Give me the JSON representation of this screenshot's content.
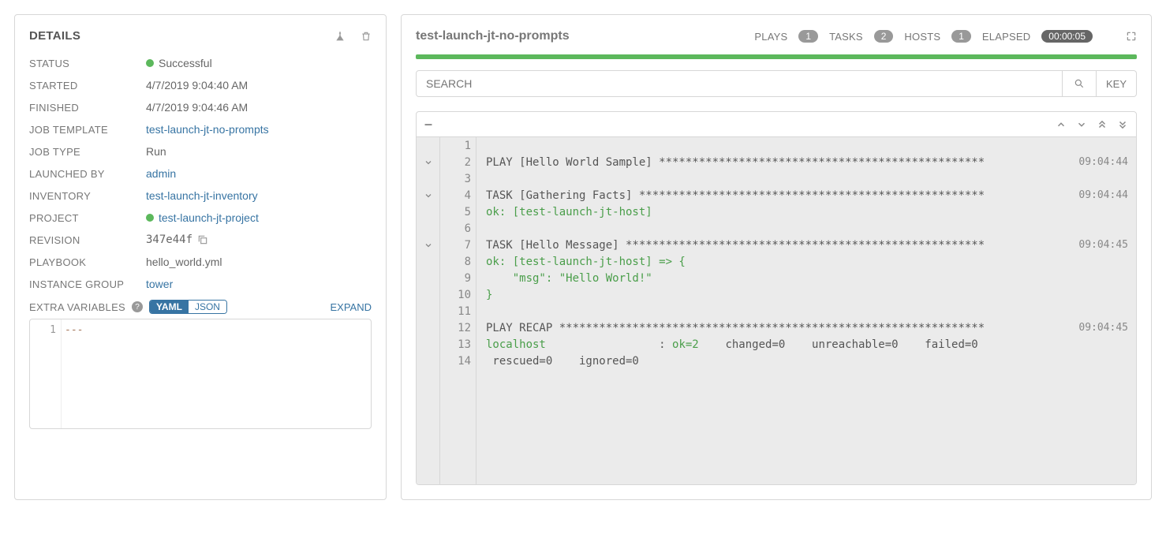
{
  "details": {
    "title": "DETAILS",
    "rows": {
      "status_label": "STATUS",
      "status_value": "Successful",
      "started_label": "STARTED",
      "started_value": "4/7/2019 9:04:40 AM",
      "finished_label": "FINISHED",
      "finished_value": "4/7/2019 9:04:46 AM",
      "template_label": "JOB TEMPLATE",
      "template_value": "test-launch-jt-no-prompts",
      "type_label": "JOB TYPE",
      "type_value": "Run",
      "launched_label": "LAUNCHED BY",
      "launched_value": "admin",
      "inventory_label": "INVENTORY",
      "inventory_value": "test-launch-jt-inventory",
      "project_label": "PROJECT",
      "project_value": "test-launch-jt-project",
      "revision_label": "REVISION",
      "revision_value": "347e44f",
      "playbook_label": "PLAYBOOK",
      "playbook_value": "hello_world.yml",
      "instancegroup_label": "INSTANCE GROUP",
      "instancegroup_value": "tower"
    },
    "extra_vars": {
      "label": "EXTRA VARIABLES",
      "yaml": "YAML",
      "json": "JSON",
      "expand": "EXPAND",
      "editor_line": "1",
      "editor_content": "---"
    }
  },
  "output": {
    "job_name": "test-launch-jt-no-prompts",
    "stats": {
      "plays_label": "PLAYS",
      "plays_count": "1",
      "tasks_label": "TASKS",
      "tasks_count": "2",
      "hosts_label": "HOSTS",
      "hosts_count": "1",
      "elapsed_label": "ELAPSED",
      "elapsed_value": "00:00:05"
    },
    "search_placeholder": "SEARCH",
    "key_label": "KEY",
    "toolbar_collapse": "–",
    "log": {
      "lines": [
        {
          "n": "1",
          "fold": "",
          "text": "",
          "ok": false,
          "ts": ""
        },
        {
          "n": "2",
          "fold": "v",
          "text": "PLAY [Hello World Sample] *************************************************",
          "ok": false,
          "ts": "09:04:44"
        },
        {
          "n": "3",
          "fold": "",
          "text": "",
          "ok": false,
          "ts": ""
        },
        {
          "n": "4",
          "fold": "v",
          "text": "TASK [Gathering Facts] ****************************************************",
          "ok": false,
          "ts": "09:04:44"
        },
        {
          "n": "5",
          "fold": "",
          "text": "ok: [test-launch-jt-host]",
          "ok": true,
          "ts": ""
        },
        {
          "n": "6",
          "fold": "",
          "text": "",
          "ok": false,
          "ts": ""
        },
        {
          "n": "7",
          "fold": "v",
          "text": "TASK [Hello Message] ******************************************************",
          "ok": false,
          "ts": "09:04:45"
        },
        {
          "n": "8",
          "fold": "",
          "text": "ok: [test-launch-jt-host] => {",
          "ok": true,
          "ts": ""
        },
        {
          "n": "9",
          "fold": "",
          "text": "    \"msg\": \"Hello World!\"",
          "ok": true,
          "ts": ""
        },
        {
          "n": "10",
          "fold": "",
          "text": "}",
          "ok": true,
          "ts": ""
        },
        {
          "n": "11",
          "fold": "",
          "text": "",
          "ok": false,
          "ts": ""
        },
        {
          "n": "12",
          "fold": "",
          "text": "PLAY RECAP ****************************************************************",
          "ok": false,
          "ts": "09:04:45"
        },
        {
          "n": "13",
          "fold": "",
          "text_html": "<span class='ok'>localhost</span>                 : <span class='ok'>ok=2</span>    changed=0    unreachable=0    failed=0",
          "ok": false,
          "ts": ""
        },
        {
          "n": "14",
          "fold": "",
          "text": " rescued=0    ignored=0",
          "ok": false,
          "ts": ""
        }
      ]
    }
  }
}
